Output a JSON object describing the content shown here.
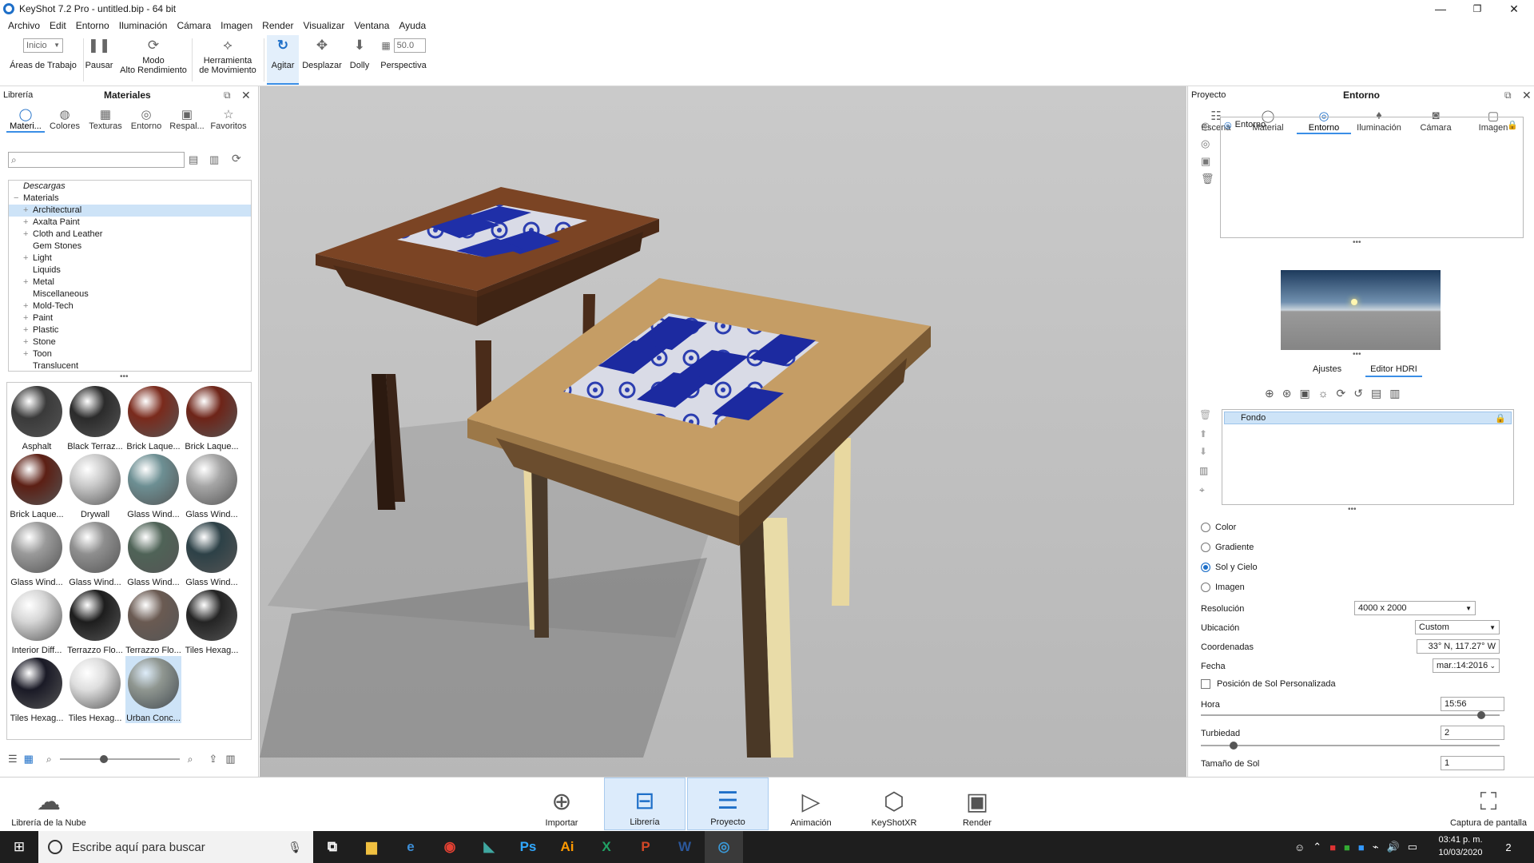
{
  "window": {
    "title": "KeyShot 7.2 Pro  - untitled.bip  - 64 bit",
    "minimize": "—",
    "maximize": "❐",
    "close": "✕"
  },
  "menu": [
    "Archivo",
    "Edit",
    "Entorno",
    "Iluminación",
    "Cámara",
    "Imagen",
    "Render",
    "Visualizar",
    "Ventana",
    "Ayuda"
  ],
  "toolbar": {
    "workspace_value": "Inicio",
    "workspaces_label": "Áreas de Trabajo",
    "pause_label": "Pausar",
    "perf_label_1": "Modo",
    "perf_label_2": "Alto Rendimiento",
    "move_label_1": "Herramienta",
    "move_label_2": "de Movimiento",
    "tumble_label": "Agitar",
    "pan_label": "Desplazar",
    "dolly_label": "Dolly",
    "perspective_label": "Perspectiva",
    "perspective_value": "50.0"
  },
  "library": {
    "header_left": "Librería",
    "header_title": "Materiales",
    "tabs": [
      {
        "label": "Materi...",
        "icon": "sphere-icon"
      },
      {
        "label": "Colores",
        "icon": "palette-icon"
      },
      {
        "label": "Texturas",
        "icon": "texture-icon"
      },
      {
        "label": "Entorno",
        "icon": "globe-icon"
      },
      {
        "label": "Respal...",
        "icon": "image-icon"
      },
      {
        "label": "Favoritos",
        "icon": "star-icon"
      }
    ],
    "search_placeholder": "",
    "tree": [
      {
        "label": "Descargas",
        "indent": 0,
        "italic": true,
        "expander": ""
      },
      {
        "label": "Materials",
        "indent": 0,
        "italic": false,
        "expander": "−"
      },
      {
        "label": "Architectural",
        "indent": 1,
        "italic": false,
        "expander": "+",
        "selected": true
      },
      {
        "label": "Axalta Paint",
        "indent": 1,
        "italic": false,
        "expander": "+"
      },
      {
        "label": "Cloth and Leather",
        "indent": 1,
        "italic": false,
        "expander": "+"
      },
      {
        "label": "Gem Stones",
        "indent": 1,
        "italic": false,
        "expander": ""
      },
      {
        "label": "Light",
        "indent": 1,
        "italic": false,
        "expander": "+"
      },
      {
        "label": "Liquids",
        "indent": 1,
        "italic": false,
        "expander": ""
      },
      {
        "label": "Metal",
        "indent": 1,
        "italic": false,
        "expander": "+"
      },
      {
        "label": "Miscellaneous",
        "indent": 1,
        "italic": false,
        "expander": ""
      },
      {
        "label": "Mold-Tech",
        "indent": 1,
        "italic": false,
        "expander": "+"
      },
      {
        "label": "Paint",
        "indent": 1,
        "italic": false,
        "expander": "+"
      },
      {
        "label": "Plastic",
        "indent": 1,
        "italic": false,
        "expander": "+"
      },
      {
        "label": "Stone",
        "indent": 1,
        "italic": false,
        "expander": "+"
      },
      {
        "label": "Toon",
        "indent": 1,
        "italic": false,
        "expander": "+"
      },
      {
        "label": "Translucent",
        "indent": 1,
        "italic": false,
        "expander": ""
      }
    ],
    "materials": [
      {
        "label": "Asphalt",
        "color": "#3a3a3a"
      },
      {
        "label": "Black Terraz...",
        "color": "#2b2b2b"
      },
      {
        "label": "Brick Laque...",
        "color": "#7a2a1c"
      },
      {
        "label": "Brick Laque...",
        "color": "#6e2418"
      },
      {
        "label": "Brick Laque...",
        "color": "#5c1f14"
      },
      {
        "label": "Drywall",
        "color": "#c9c9c9"
      },
      {
        "label": "Glass Wind...",
        "color": "#6d8f93"
      },
      {
        "label": "Glass Wind...",
        "color": "#a6a6a6"
      },
      {
        "label": "Glass Wind...",
        "color": "#9a9a9a"
      },
      {
        "label": "Glass Wind...",
        "color": "#8f8f8f"
      },
      {
        "label": "Glass Wind...",
        "color": "#4f6357"
      },
      {
        "label": "Glass Wind...",
        "color": "#2d4147"
      },
      {
        "label": "Interior Diff...",
        "color": "#d6d6d6"
      },
      {
        "label": "Terrazzo Flo...",
        "color": "#1d1d1d"
      },
      {
        "label": "Terrazzo Flo...",
        "color": "#6a5a52"
      },
      {
        "label": "Tiles Hexag...",
        "color": "#242424"
      },
      {
        "label": "Tiles Hexag...",
        "color": "#1a1a26"
      },
      {
        "label": "Tiles Hexag...",
        "color": "#dedede"
      },
      {
        "label": "Urban Conc...",
        "color": "#8f9690",
        "selected": true
      }
    ]
  },
  "project": {
    "header_left": "Proyecto",
    "header_title": "Entorno",
    "tabs": [
      {
        "label": "Escena",
        "icon": "scene-icon"
      },
      {
        "label": "Material",
        "icon": "material-icon"
      },
      {
        "label": "Entorno",
        "icon": "globe-icon"
      },
      {
        "label": "Iluminación",
        "icon": "bulb-icon"
      },
      {
        "label": "Cámara",
        "icon": "camera-icon"
      },
      {
        "label": "Imagen",
        "icon": "image-frame-icon"
      }
    ],
    "env_item": "Entorno",
    "subtabs": [
      "Ajustes",
      "Editor HDRI"
    ],
    "layer_item": "Fondo",
    "radios": [
      {
        "label": "Color",
        "checked": false
      },
      {
        "label": "Gradiente",
        "checked": false
      },
      {
        "label": "Sol y Cielo",
        "checked": true
      },
      {
        "label": "Imagen",
        "checked": false
      }
    ],
    "resolution_label": "Resolución",
    "resolution_value": "4000 x 2000",
    "location_label": "Ubicación",
    "location_value": "Custom",
    "coords_label": "Coordenadas",
    "coords_value": "33° N, 117.27° W",
    "date_label": "Fecha",
    "date_value": "mar.:14:2016",
    "custom_sun_label": "Posición de Sol Personalizada",
    "hour_label": "Hora",
    "hour_value": "15:56",
    "hour_level": 0.95,
    "turbidity_label": "Turbiedad",
    "turbidity_value": "2",
    "turbidity_level": 0.1,
    "sunsize_label": "Tamaño de Sol",
    "sunsize_value": "1"
  },
  "bottom": {
    "cloud_label": "Librería de la Nube",
    "import_label": "Importar",
    "library_label": "Librería",
    "project_label": "Proyecto",
    "animation_label": "Animación",
    "xr_label": "KeyShotXR",
    "render_label": "Render",
    "capture_label": "Captura de pantalla"
  },
  "taskbar": {
    "search_placeholder": "Escribe aquí para buscar",
    "time": "03:41 p. m.",
    "date": "10/03/2020",
    "notifications": "2",
    "apps": [
      {
        "name": "task-view-icon",
        "glyph": "⧉",
        "color": "#ffffff"
      },
      {
        "name": "file-explorer-icon",
        "glyph": "▆",
        "color": "#f0c040"
      },
      {
        "name": "edge-icon",
        "glyph": "e",
        "color": "#3d8fd8"
      },
      {
        "name": "chrome-icon",
        "glyph": "◉",
        "color": "#e34133"
      },
      {
        "name": "app-icon",
        "glyph": "◣",
        "color": "#3fa7a0"
      },
      {
        "name": "photoshop-icon",
        "glyph": "Ps",
        "color": "#31a8ff"
      },
      {
        "name": "illustrator-icon",
        "glyph": "Ai",
        "color": "#ff9a00"
      },
      {
        "name": "excel-icon",
        "glyph": "X",
        "color": "#21a366"
      },
      {
        "name": "powerpoint-icon",
        "glyph": "P",
        "color": "#d24726"
      },
      {
        "name": "word-icon",
        "glyph": "W",
        "color": "#2b579a"
      },
      {
        "name": "keyshot-icon",
        "glyph": "◎",
        "color": "#3a9ad9"
      }
    ]
  },
  "colors": {
    "accent": "#1e6fc8",
    "selection": "#cde3f7",
    "wood_dark": "#6b3a1f",
    "wood_light": "#c9a46a",
    "tile_blue": "#1c2aa0",
    "floor": "#bdbdbd"
  }
}
